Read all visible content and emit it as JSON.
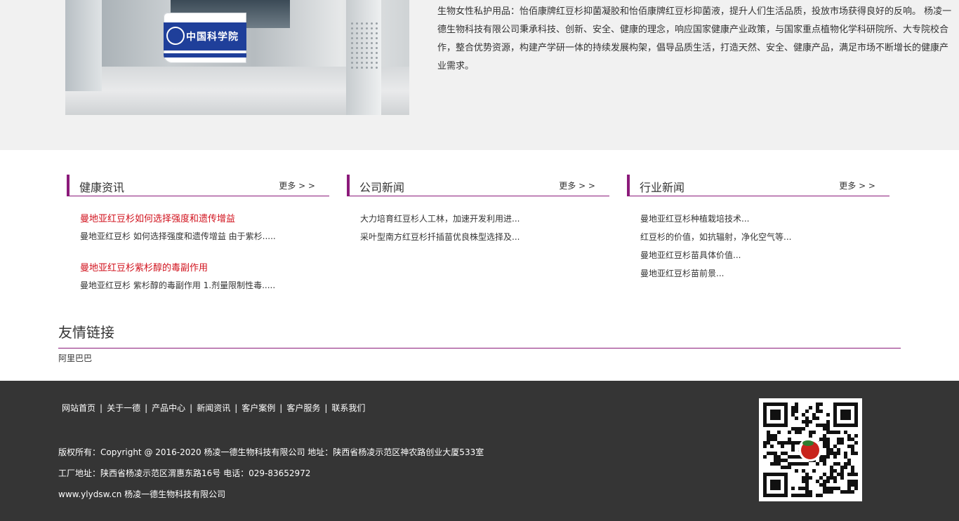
{
  "about": {
    "photo_sign_text": "中国科学院",
    "description": "生物女性私护用品：怡佰康牌红豆杉抑菌凝胶和怡佰康牌红豆杉抑菌液，提升人们生活品质，投放市场获得良好的反响。 杨凌一德生物科技有限公司秉承科技、创新、安全、健康的理念，响应国家健康产业政策，与国家重点植物化学科研院所、大专院校合作，整合优势资源，构建产学研一体的持续发展构架，倡导品质生活，打造天然、安全、健康产品，满足市场不断增长的健康产业需求。"
  },
  "health_news": {
    "title": "健康资讯",
    "more": "更多 > >",
    "items": [
      {
        "title": "曼地亚红豆杉如何选择强度和遗传增益",
        "desc": "曼地亚红豆杉 如何选择强度和遗传增益 由于紫杉....."
      },
      {
        "title": "曼地亚红豆杉紫杉醇的毒副作用",
        "desc": "曼地亚红豆杉 紫杉醇的毒副作用 1.剂量限制性毒....."
      }
    ]
  },
  "company_news": {
    "title": "公司新闻",
    "more": "更多 > >",
    "items": [
      "大力培育红豆杉人工林，加速开发利用进...",
      "采叶型南方红豆杉扦插苗优良株型选择及..."
    ]
  },
  "industry_news": {
    "title": "行业新闻",
    "more": "更多 > >",
    "items": [
      "曼地亚红豆杉种植栽培技术...",
      "红豆杉的价值，如抗辐射，净化空气等...",
      "曼地亚红豆杉苗具体价值...",
      "曼地亚红豆杉苗前景..."
    ]
  },
  "links": {
    "title": "友情链接",
    "items": [
      "阿里巴巴"
    ]
  },
  "footer": {
    "nav": [
      "网站首页",
      "关于一德",
      "产品中心",
      "新闻资讯",
      "客户案例",
      "客户服务",
      "联系我们"
    ],
    "separator": "|",
    "copyright": "版权所有：Copyright @ 2016-2020 杨凌一德生物科技有限公司 地址：陕西省杨凌示范区神农路创业大厦533室",
    "factory": "工厂地址：陕西省杨凌示范区渭惠东路16号 电话：029-83652972",
    "site": "www.ylydsw.cn 杨凌一德生物科技有限公司",
    "qr_icon": "qr-code-icon"
  },
  "colors": {
    "accent": "#8b1a7a",
    "highlight": "#d1121d",
    "footer_bg": "#353535",
    "about_bg": "#f1f1f1"
  }
}
